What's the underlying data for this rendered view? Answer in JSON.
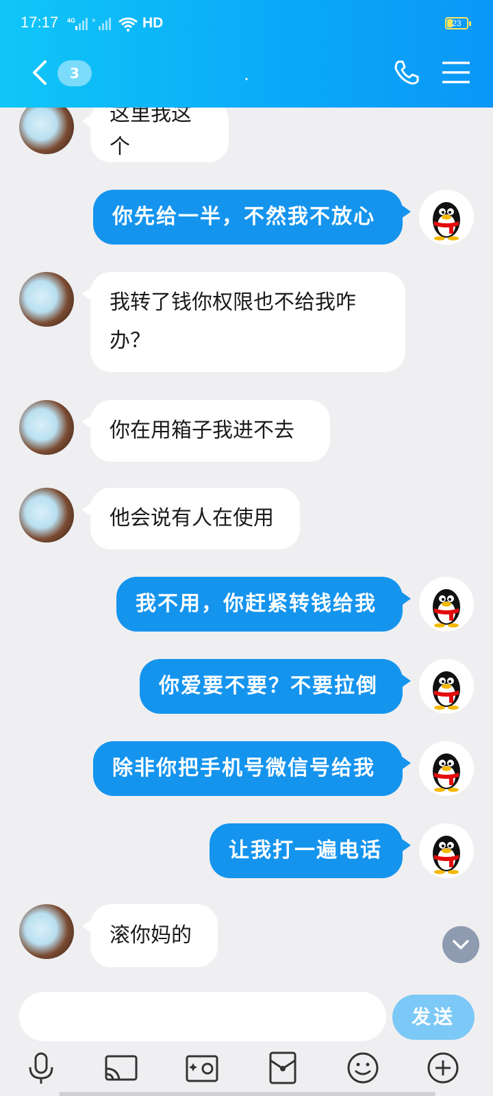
{
  "status_bar": {
    "time": "17:17",
    "network": "HD",
    "battery": "23",
    "signal_label": "4G"
  },
  "header": {
    "unread_count": "3",
    "title": "."
  },
  "messages": [
    {
      "side": "in",
      "text": "这里我这个"
    },
    {
      "side": "out",
      "text": "你先给一半，不然我不放心"
    },
    {
      "side": "in",
      "text": "我转了钱你权限也不给我咋办？"
    },
    {
      "side": "in",
      "text": "你在用箱子我进不去"
    },
    {
      "side": "in",
      "text": "他会说有人在使用"
    },
    {
      "side": "out",
      "text": "我不用，你赶紧转钱给我"
    },
    {
      "side": "out",
      "text": "你爱要不要？不要拉倒"
    },
    {
      "side": "out",
      "text": "除非你把手机号微信号给我"
    },
    {
      "side": "out",
      "text": "让我打一遍电话"
    },
    {
      "side": "in",
      "text": "滚你妈的"
    }
  ],
  "input": {
    "placeholder": "",
    "send_label": "发送"
  },
  "toolbar": [
    "microphone-icon",
    "cast-icon",
    "photo-icon",
    "red-packet-icon",
    "emoji-icon",
    "plus-icon"
  ],
  "colors": {
    "header_gradient_start": "#10c6f7",
    "header_gradient_end": "#0a97f7",
    "outgoing_bubble": "#1594ee",
    "send_button": "#7cc8f6"
  }
}
